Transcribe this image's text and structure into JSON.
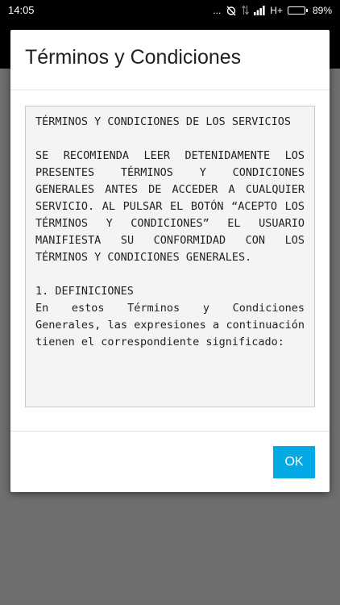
{
  "status_bar": {
    "time": "14:05",
    "dots": "...",
    "network": "H+",
    "battery": "89%",
    "battery_level": 0.89
  },
  "dialog": {
    "title": "Términos y Condiciones",
    "terms": {
      "heading": "TÉRMINOS Y CONDICIONES DE LOS SERVICIOS",
      "intro": "SE RECOMIENDA LEER DETENIDAMENTE LOS PRESENTES TÉRMINOS Y CONDICIONES GENERALES ANTES DE ACCEDER A CUALQUIER SERVICIO. AL PULSAR EL BOTÓN “ACEPTO LOS TÉRMINOS Y CONDICIONES” EL USUARIO MANIFIESTA SU CONFORMIDAD CON LOS TÉRMINOS Y CONDICIONES GENERALES.",
      "section_title": "1. DEFINICIONES",
      "section_body": "En estos Términos y Condiciones Generales, las expresiones a continuación tienen el correspondiente significado:"
    },
    "ok_label": "OK"
  }
}
